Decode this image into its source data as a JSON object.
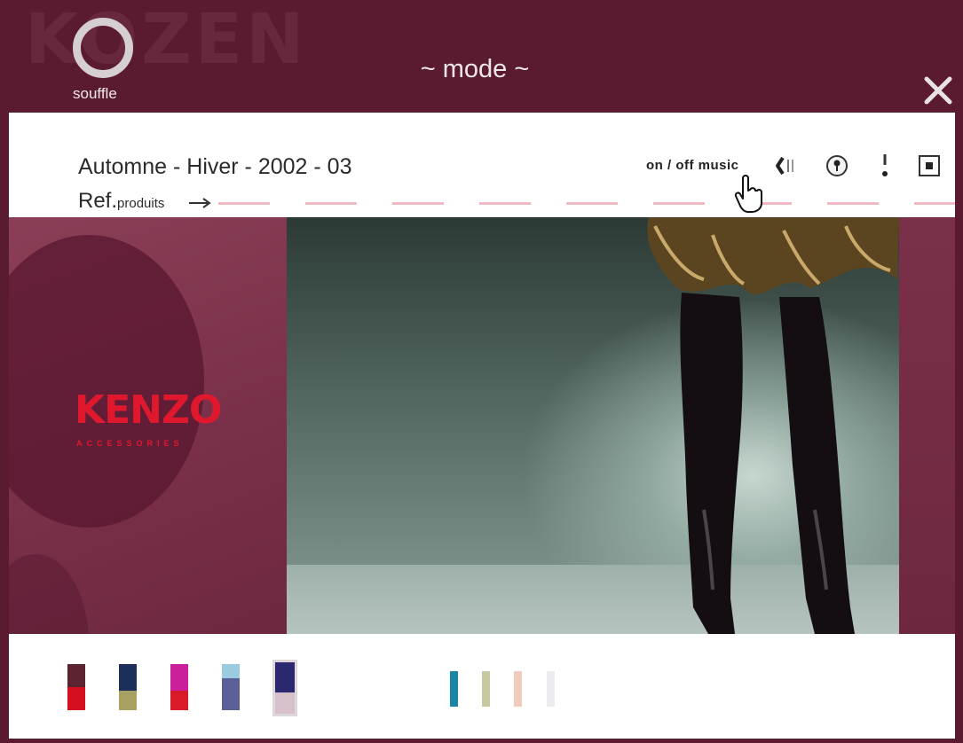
{
  "header": {
    "brand_word": "KOZEN",
    "brand_sub": "souffle",
    "section_title": "~ mode ~"
  },
  "top_panel": {
    "season": "Automne - Hiver - 2002 - 03",
    "ref_main": "Ref.",
    "ref_sub": "produits",
    "music_toggle": "on / off music"
  },
  "main": {
    "logo_text": "KENZO",
    "logo_sub": "ACCESSORIES"
  },
  "colors": {
    "background": "#5a1a30",
    "panel": "#ffffff",
    "accent_dash": "#f0b9c2",
    "logo": "#e0182e"
  },
  "icons": [
    "close-icon",
    "speaker-icon",
    "info-icon",
    "exclamation-icon",
    "window-icon",
    "hand-cursor-icon",
    "arrow-right-icon"
  ],
  "swatches": [
    {
      "top": "#5c2330",
      "bottom": "#d60f20"
    },
    {
      "top": "#1c2e5a",
      "bottom": "#a8a060"
    },
    {
      "top": "#cc1f9c",
      "bottom": "#d81b28"
    },
    {
      "top": "#9ccbe0",
      "bottom": "#5b5f98"
    },
    {
      "top": "#2c2870",
      "bottom": "#d8bfcc"
    }
  ],
  "mini_swatches": [
    "#1a86a6",
    "#c8c8a0",
    "#f0ccbc",
    "#ecebef"
  ]
}
